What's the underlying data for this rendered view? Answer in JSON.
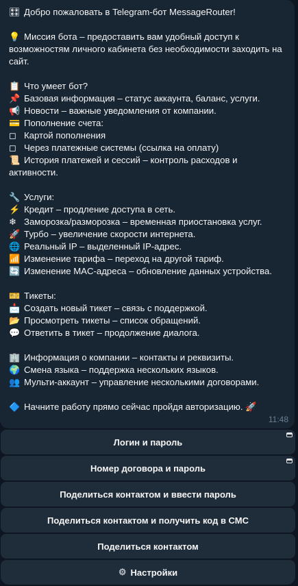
{
  "message": {
    "lines": [
      {
        "emoji": "🎛",
        "icon": "control-knobs-icon",
        "text": "Добро пожаловать в Telegram-бот MessageRouter!"
      },
      {
        "emoji": "",
        "text": ""
      },
      {
        "emoji": "💡",
        "icon": "light-bulb-icon",
        "text": "Миссия бота – предоставить вам удобный доступ к возможностям личного кабинета без необходимости заходить на сайт."
      },
      {
        "emoji": "",
        "text": ""
      },
      {
        "emoji": "📋",
        "icon": "clipboard-icon",
        "text": "Что умеет бот?"
      },
      {
        "emoji": "📌",
        "icon": "pushpin-icon",
        "text": "Базовая информация – статус аккаунта, баланс, услуги."
      },
      {
        "emoji": "📢",
        "icon": "loudspeaker-icon",
        "text": "Новости – важные уведомления от компании."
      },
      {
        "emoji": "💳",
        "icon": "credit-card-icon",
        "text": "Пополнение счета:"
      },
      {
        "emoji": "◻",
        "icon": "white-square-icon",
        "text": "Картой пополнения"
      },
      {
        "emoji": "◻",
        "icon": "white-square-icon",
        "text": "Через платежные системы (ссылка на оплату)"
      },
      {
        "emoji": "📜",
        "icon": "scroll-icon",
        "text": "История платежей и сессий – контроль расходов и активности."
      },
      {
        "emoji": "",
        "text": ""
      },
      {
        "emoji": "🔧",
        "icon": "wrench-icon",
        "text": "Услуги:"
      },
      {
        "emoji": "⚡",
        "icon": "lightning-icon",
        "text": "Кредит – продление доступа в сеть."
      },
      {
        "emoji": "❄",
        "icon": "snowflake-icon",
        "text": "Заморозка/разморозка – временная приостановка услуг."
      },
      {
        "emoji": "🚀",
        "icon": "rocket-icon",
        "text": "Турбо – увеличение скорости интернета."
      },
      {
        "emoji": "🌐",
        "icon": "globe-icon",
        "text": "Реальный IP – выделенный IP-адрес."
      },
      {
        "emoji": "📶",
        "icon": "signal-bars-icon",
        "text": "Изменение тарифа – переход на другой тариф."
      },
      {
        "emoji": "🔄",
        "icon": "refresh-icon",
        "text": "Изменение MAC-адреса – обновление данных устройства."
      },
      {
        "emoji": "",
        "text": ""
      },
      {
        "emoji": "🎫",
        "icon": "ticket-icon",
        "text": "Тикеты:"
      },
      {
        "emoji": "📩",
        "icon": "envelope-arrow-icon",
        "text": "Создать новый тикет – связь с поддержкой."
      },
      {
        "emoji": "📂",
        "icon": "folder-icon",
        "text": "Просмотреть тикеты – список обращений."
      },
      {
        "emoji": "💬",
        "icon": "speech-bubble-icon",
        "text": "Ответить в тикет – продолжение диалога."
      },
      {
        "emoji": "",
        "text": ""
      },
      {
        "emoji": "🏢",
        "icon": "office-building-icon",
        "text": "Информация о компании – контакты и реквизиты."
      },
      {
        "emoji": "🌍",
        "icon": "globe-europe-icon",
        "text": "Смена языка – поддержка нескольких языков."
      },
      {
        "emoji": "👥",
        "icon": "people-icon",
        "text": "Мульти-аккаунт – управление несколькими договорами."
      },
      {
        "emoji": "",
        "text": ""
      },
      {
        "emoji": "🔷",
        "icon": "blue-diamond-icon",
        "text": "Начните работу прямо сейчас пройдя авторизацию. 🚀"
      }
    ],
    "time": "11:48"
  },
  "keyboard": [
    {
      "label": "Логин и пароль",
      "webapp": true
    },
    {
      "label": "Номер договора и пароль",
      "webapp": true
    },
    {
      "label": "Поделиться контактом и ввести пароль",
      "webapp": false
    },
    {
      "label": "Поделиться контактом и получить код в СМС",
      "webapp": false
    },
    {
      "label": "Поделиться контактом",
      "webapp": false
    },
    {
      "label": "Настройки",
      "webapp": false,
      "emoji": "⚙",
      "icon": "gear-icon"
    }
  ],
  "colors": {
    "background": "#0e1621",
    "bubble": "#182533",
    "button": "#1f2c3a",
    "time": "#6d7f8f"
  }
}
